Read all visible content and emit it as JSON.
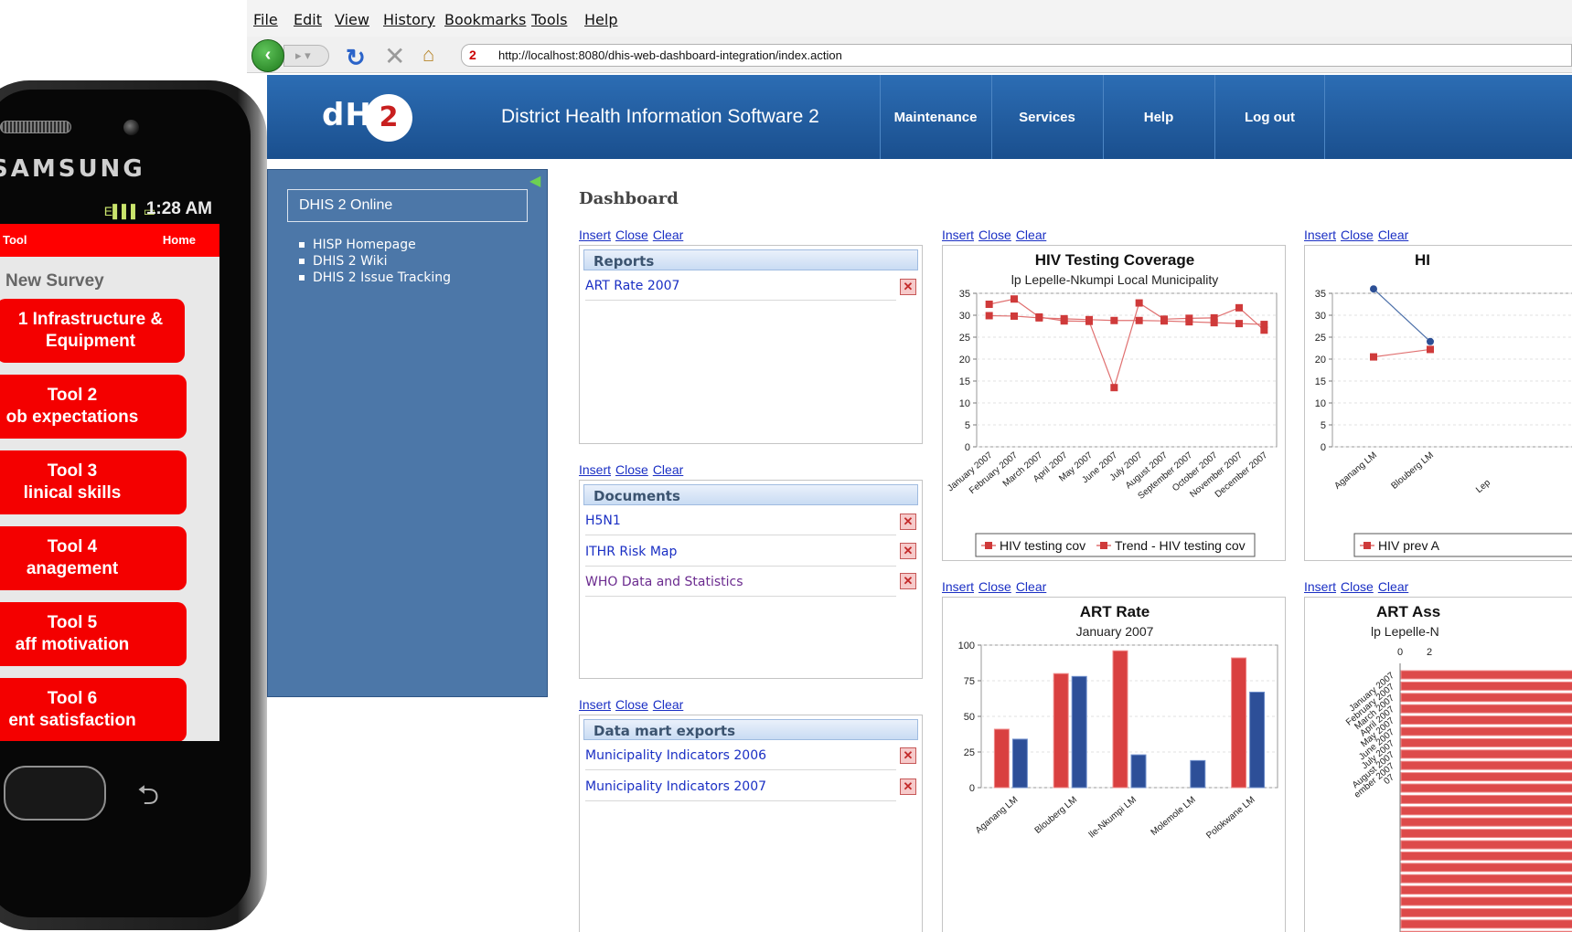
{
  "phone": {
    "brand": "SAMSUNG",
    "time": "1:28 AM",
    "status_icons": "E▌▌▌ ▭",
    "app_title": "Tool",
    "home": "Home",
    "survey_title": "New Survey",
    "tools": [
      {
        "line1": "1 Infrastructure &",
        "line2": "Equipment"
      },
      {
        "line1": "Tool 2",
        "line2": "ob expectations"
      },
      {
        "line1": "Tool 3",
        "line2": "linical skills"
      },
      {
        "line1": "Tool 4",
        "line2": "anagement"
      },
      {
        "line1": "Tool 5",
        "line2": "aff motivation"
      },
      {
        "line1": "Tool 6",
        "line2": "ent satisfaction"
      }
    ]
  },
  "browser": {
    "menu": [
      "File",
      "Edit",
      "View",
      "History",
      "Bookmarks",
      "Tools",
      "Help"
    ],
    "url": "http://localhost:8080/dhis-web-dashboard-integration/index.action",
    "site_icon": "2"
  },
  "header": {
    "logo": "dHIS",
    "logo_badge": "2",
    "title": "District Health Information Software 2",
    "nav": [
      "Maintenance",
      "Services",
      "Help",
      "Log out"
    ]
  },
  "left": {
    "box": "DHIS 2 Online",
    "links": [
      "HISP Homepage",
      "DHIS 2 Wiki",
      "DHIS 2 Issue Tracking"
    ]
  },
  "dashboard": {
    "title": "Dashboard",
    "ctrl": {
      "insert": "Insert",
      "close": "Close",
      "clear": "Clear"
    },
    "reports": {
      "heading": "Reports",
      "items": [
        "ART Rate 2007"
      ]
    },
    "documents": {
      "heading": "Documents",
      "items": [
        "H5N1",
        "ITHR Risk Map",
        "WHO Data and Statistics"
      ]
    },
    "datamart": {
      "heading": "Data mart exports",
      "items": [
        "Municipality Indicators 2006",
        "Municipality Indicators 2007"
      ]
    }
  },
  "colors": {
    "red": "#dd4a4a",
    "blue": "#3a62a8",
    "header": "#1f5a9c"
  },
  "chart_data": [
    {
      "type": "line",
      "title": "HIV Testing Coverage",
      "subtitle": "lp Lepelle-Nkumpi Local Municipality",
      "categories": [
        "January 2007",
        "February 2007",
        "March 2007",
        "April 2007",
        "May 2007",
        "June 2007",
        "July 2007",
        "August 2007",
        "September 2007",
        "October 2007",
        "November 2007",
        "December 2007"
      ],
      "ylim": [
        0,
        35
      ],
      "yticks": [
        "0",
        "5",
        "10",
        "15",
        "20",
        "25",
        "30",
        "35"
      ],
      "legend_position": "bottom",
      "series": [
        {
          "name": "HIV testing cov",
          "values": [
            32.5,
            33.7,
            29.6,
            28.7,
            28.6,
            13.5,
            32.8,
            29.1,
            29.3,
            29.4,
            31.7,
            26.6
          ]
        },
        {
          "name": "Trend - HIV testing cov",
          "values": [
            29.9,
            29.8,
            29.4,
            29.2,
            29.0,
            28.8,
            28.8,
            28.7,
            28.5,
            28.3,
            28.1,
            27.9
          ]
        }
      ]
    },
    {
      "type": "line",
      "title": "HI",
      "categories": [
        "Aganang LM",
        "Blouberg LM",
        "Lep"
      ],
      "ylim": [
        0,
        35
      ],
      "yticks": [
        "0",
        "5",
        "10",
        "15",
        "20",
        "25",
        "30",
        "35"
      ],
      "legend_position": "bottom",
      "series": [
        {
          "name": "",
          "values": [
            36,
            24
          ]
        },
        {
          "name": "HIV prev A",
          "values": [
            20.5,
            22.2
          ]
        }
      ]
    },
    {
      "type": "bar",
      "title": "ART Rate",
      "subtitle": "January 2007",
      "categories": [
        "Aganang LM",
        "Blouberg LM",
        "lle-Nkumpi LM",
        "Molemole LM",
        "Polokwane LM"
      ],
      "ylim": [
        0,
        100
      ],
      "yticks": [
        "0",
        "25",
        "50",
        "75",
        "100"
      ],
      "series": [
        {
          "name": "",
          "values": [
            41,
            80,
            96,
            0,
            91
          ]
        },
        {
          "name": "",
          "values": [
            34,
            78,
            23,
            19,
            67
          ]
        }
      ]
    },
    {
      "type": "bar",
      "title": "ART Ass",
      "subtitle": "lp Lepelle-N",
      "xticks": [
        "0",
        "2"
      ],
      "categories": [
        "January 2007",
        "February 2007",
        "March 2007",
        "April 2007",
        "May 2007",
        "June 2007",
        "July 2007",
        "August 2007",
        "ember 2007",
        "07"
      ],
      "values": []
    }
  ]
}
